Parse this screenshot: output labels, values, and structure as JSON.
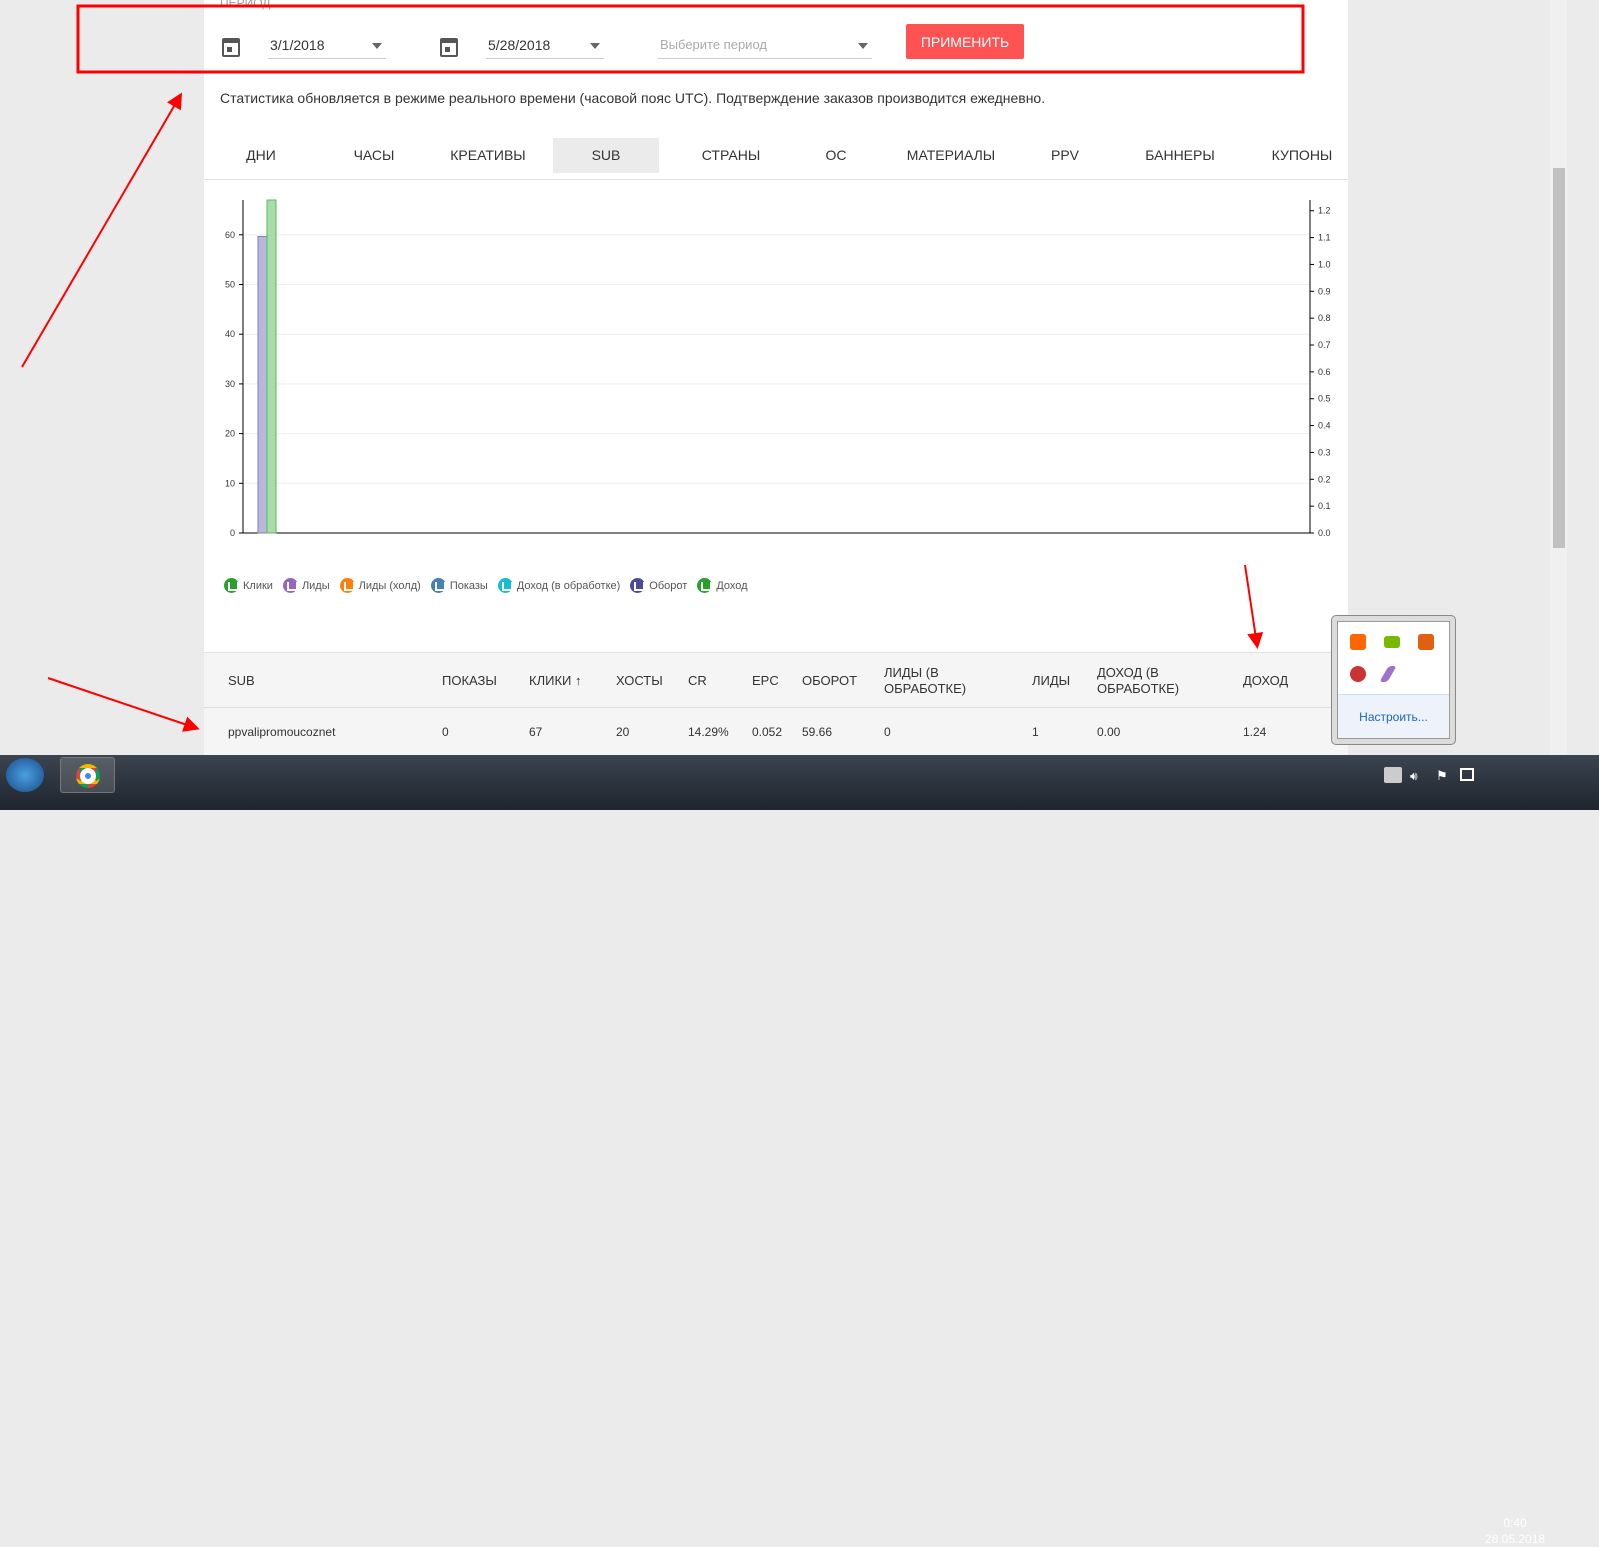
{
  "filters": {
    "label": "ПЕРИОД",
    "date_from": "3/1/2018",
    "date_to": "5/28/2018",
    "period_placeholder": "Выберите период",
    "apply_label": "ПРИМЕНИТЬ"
  },
  "info_text": "Статистика обновляется в режиме реального времени (часовой пояс UTC). Подтверждение заказов производится ежедневно.",
  "tabs": [
    "ДНИ",
    "ЧАСЫ",
    "КРЕАТИВЫ",
    "SUB",
    "СТРАНЫ",
    "ОС",
    "МАТЕРИАЛЫ",
    "PPV",
    "БАННЕРЫ",
    "КУПОНЫ"
  ],
  "active_tab": "SUB",
  "chart_data": {
    "type": "bar",
    "categories": [
      "ppvalipromoucoznet"
    ],
    "series": [
      {
        "name": "Оборот",
        "values": [
          59.66
        ],
        "axis": "left",
        "color": "#b8b8dc"
      },
      {
        "name": "Клики",
        "values": [
          67
        ],
        "axis": "left",
        "color": "#a8dca8"
      }
    ],
    "left_axis": {
      "ticks": [
        0,
        10,
        20,
        30,
        40,
        50,
        60
      ],
      "range": [
        0,
        67
      ]
    },
    "right_axis": {
      "ticks": [
        "0.0",
        "0.1",
        "0.2",
        "0.3",
        "0.4",
        "0.5",
        "0.6",
        "0.7",
        "0.8",
        "0.9",
        "1.0",
        "1.1",
        "1.2"
      ],
      "range": [
        0,
        1.24
      ]
    },
    "legend": [
      {
        "name": "Клики",
        "color": "#2ca02c"
      },
      {
        "name": "Лиды",
        "color": "#9467bd"
      },
      {
        "name": "Лиды (холд)",
        "color": "#ff7f0e"
      },
      {
        "name": "Показы",
        "color": "#4682b4"
      },
      {
        "name": "Доход (в обработке)",
        "color": "#17becf"
      },
      {
        "name": "Оборот",
        "color": "#4b4b9b"
      },
      {
        "name": "Доход",
        "color": "#2ca02c"
      }
    ]
  },
  "table": {
    "headers": [
      "SUB",
      "ПОКАЗЫ",
      "КЛИКИ ↑",
      "ХОСТЫ",
      "CR",
      "EPC",
      "ОБОРОТ",
      "ЛИДЫ (В ОБРАБОТКЕ)",
      "ЛИДЫ",
      "ДОХОД (В ОБРАБОТКЕ)",
      "ДОХОД"
    ],
    "rows": [
      [
        "ppvalipromoucoznet",
        "0",
        "67",
        "20",
        "14.29%",
        "0.052",
        "59.66",
        "0",
        "1",
        "0.00",
        "1.24"
      ]
    ]
  },
  "tray": {
    "customize": "Настроить..."
  },
  "clock": {
    "time": "0:40",
    "date": "28.05.2018"
  }
}
